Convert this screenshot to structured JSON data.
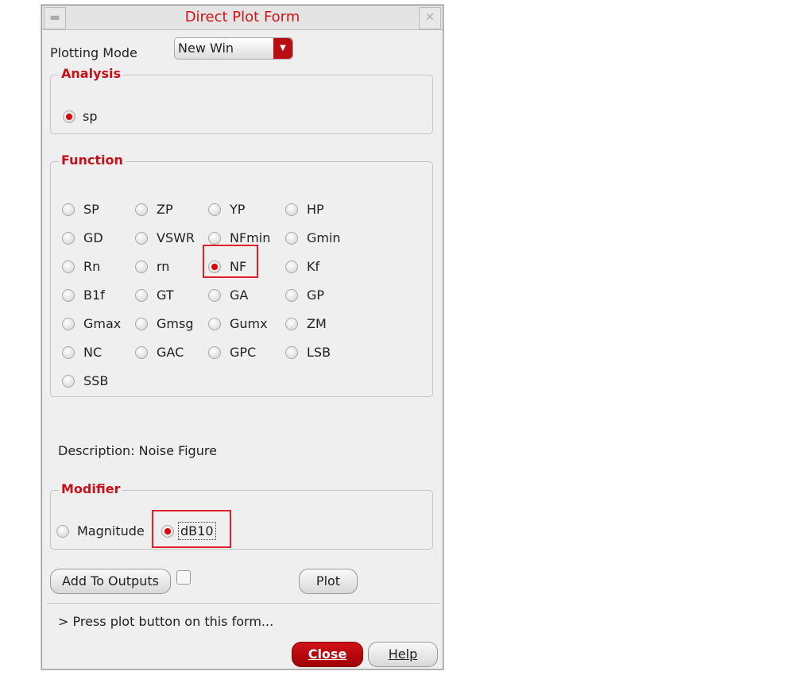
{
  "window": {
    "title": "Direct Plot Form"
  },
  "plotting_mode": {
    "label": "Plotting Mode",
    "value": "New Win"
  },
  "analysis": {
    "legend": "Analysis",
    "options": [
      {
        "label": "sp",
        "selected": true
      }
    ]
  },
  "function": {
    "legend": "Function",
    "options": [
      {
        "label": "SP"
      },
      {
        "label": "ZP"
      },
      {
        "label": "YP"
      },
      {
        "label": "HP"
      },
      {
        "label": "GD"
      },
      {
        "label": "VSWR"
      },
      {
        "label": "NFmin"
      },
      {
        "label": "Gmin"
      },
      {
        "label": "Rn"
      },
      {
        "label": "rn"
      },
      {
        "label": "NF",
        "selected": true
      },
      {
        "label": "Kf"
      },
      {
        "label": "B1f"
      },
      {
        "label": "GT"
      },
      {
        "label": "GA"
      },
      {
        "label": "GP"
      },
      {
        "label": "Gmax"
      },
      {
        "label": "Gmsg"
      },
      {
        "label": "Gumx"
      },
      {
        "label": "ZM"
      },
      {
        "label": "NC"
      },
      {
        "label": "GAC"
      },
      {
        "label": "GPC"
      },
      {
        "label": "LSB"
      },
      {
        "label": "SSB"
      }
    ]
  },
  "description": "Description: Noise Figure",
  "modifier": {
    "legend": "Modifier",
    "options": [
      {
        "label": "Magnitude"
      },
      {
        "label": "dB10",
        "selected": true
      }
    ]
  },
  "buttons": {
    "add_to_outputs": "Add To Outputs",
    "plot": "Plot",
    "close": "Close",
    "help": "Help"
  },
  "status": "> Press plot button on this form...",
  "colors": {
    "accent": "#d0141c"
  }
}
